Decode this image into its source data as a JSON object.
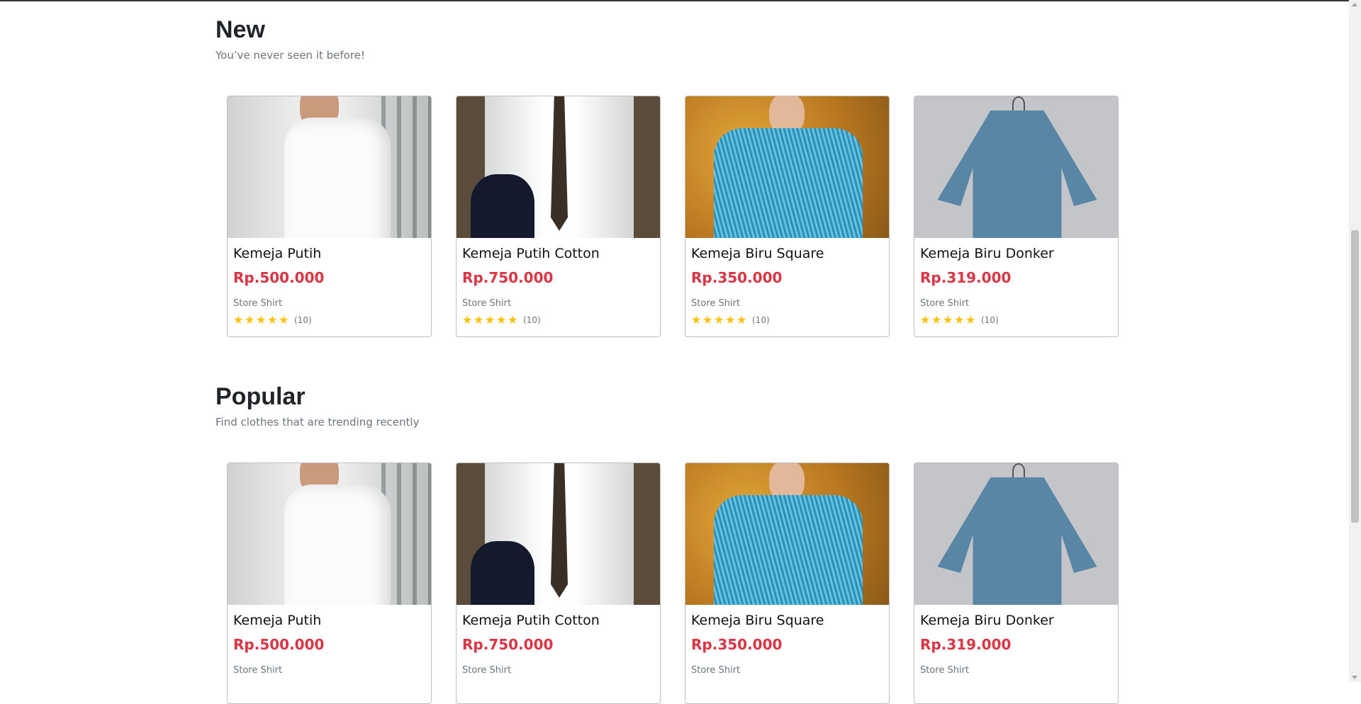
{
  "sections": [
    {
      "title": "New",
      "subtitle": "You’ve never seen it before!",
      "products": [
        {
          "name": "Kemeja Putih",
          "price": "Rp.500.000",
          "store": "Store Shirt",
          "rating": 5,
          "reviews": "(10)",
          "image": "white-shirt-man"
        },
        {
          "name": "Kemeja Putih Cotton",
          "price": "Rp.750.000",
          "store": "Store Shirt",
          "rating": 5,
          "reviews": "(10)",
          "image": "white-shirt-tie"
        },
        {
          "name": "Kemeja Biru Square",
          "price": "Rp.350.000",
          "store": "Store Shirt",
          "rating": 5,
          "reviews": "(10)",
          "image": "blue-shirt-autumn"
        },
        {
          "name": "Kemeja Biru Donker",
          "price": "Rp.319.000",
          "store": "Store Shirt",
          "rating": 5,
          "reviews": "(10)",
          "image": "navy-shirt-hanger"
        }
      ]
    },
    {
      "title": "Popular",
      "subtitle": "Find clothes that are trending recently",
      "products": [
        {
          "name": "Kemeja Putih",
          "price": "Rp.500.000",
          "store": "Store Shirt",
          "image": "white-shirt-man"
        },
        {
          "name": "Kemeja Putih Cotton",
          "price": "Rp.750.000",
          "store": "Store Shirt",
          "image": "white-shirt-tie"
        },
        {
          "name": "Kemeja Biru Square",
          "price": "Rp.350.000",
          "store": "Store Shirt",
          "image": "blue-shirt-autumn"
        },
        {
          "name": "Kemeja Biru Donker",
          "price": "Rp.319.000",
          "store": "Store Shirt",
          "image": "navy-shirt-hanger"
        }
      ]
    }
  ],
  "colors": {
    "price": "#db3545",
    "star": "#ffc107",
    "muted": "#6c757d"
  }
}
